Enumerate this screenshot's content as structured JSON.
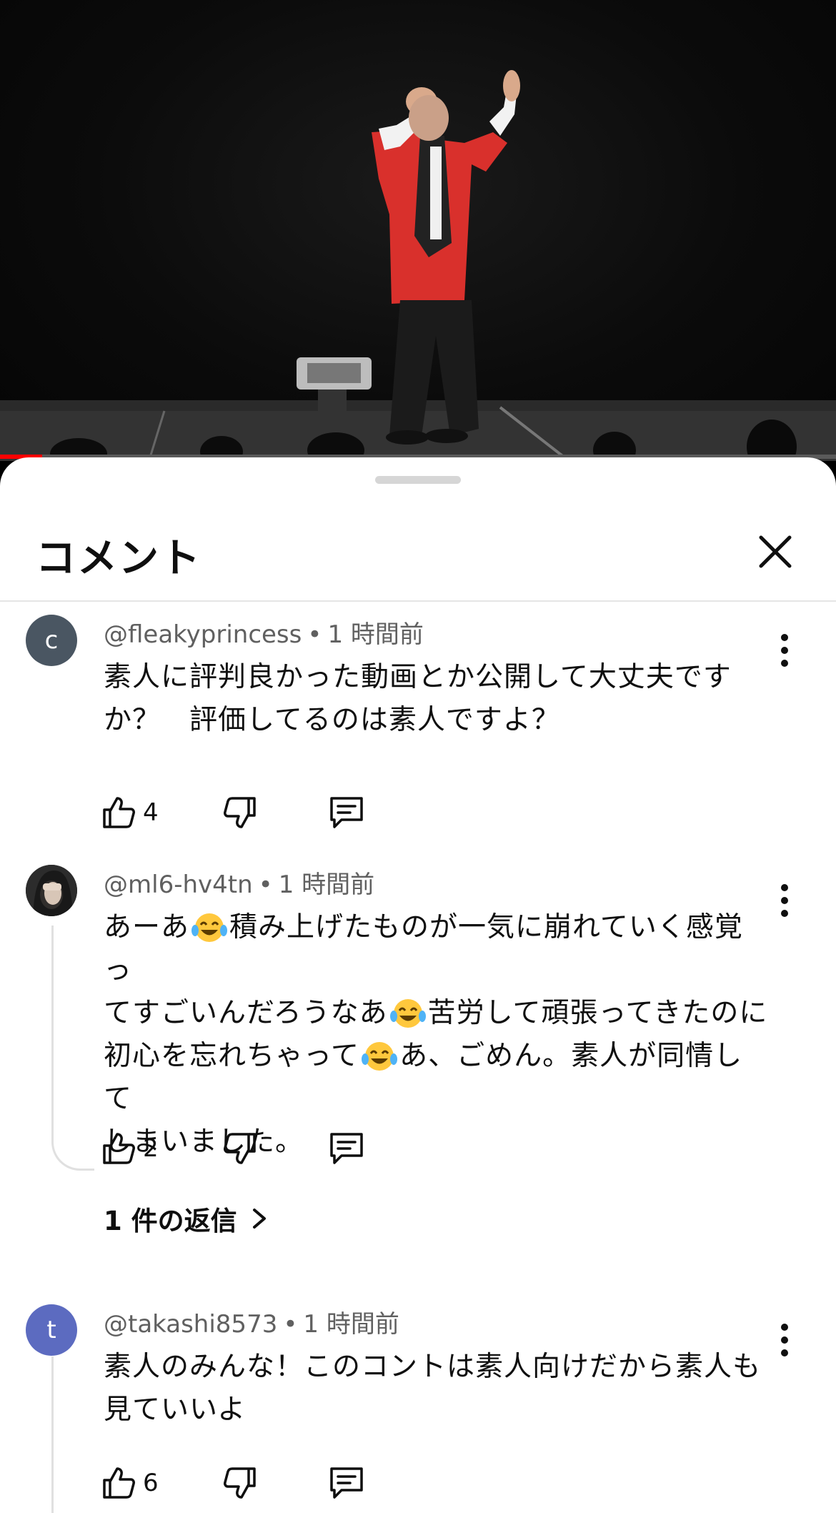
{
  "player": {
    "progress_fraction": 0.05
  },
  "panel": {
    "title": "コメント"
  },
  "comments": [
    {
      "avatar_letter": "c",
      "avatar_color": "#4a5662",
      "handle": "@fleakyprincess",
      "separator": "•",
      "time": "1 時間前",
      "lines": [
        "素人に評判良かった動画とか公開して大丈夫です",
        "か？　評価してるのは素人ですよ？"
      ],
      "likes": "4"
    },
    {
      "avatar_letter": "",
      "avatar_color": "#3a3a3a",
      "handle": "@ml6-hv4tn",
      "separator": "•",
      "time": "1 時間前",
      "segments": [
        [
          "あーあ",
          "積み上げたものが一気に崩れていく感覚っ"
        ],
        [
          "てすごいんだろうなあ",
          "苦労して頑張ってきたのに"
        ],
        [
          "初心を忘れちゃって",
          "あ、ごめん。素人が同情して"
        ],
        [
          "しまいました。"
        ]
      ],
      "emoji_name": "tears-of-joy-emoji",
      "likes": "2",
      "replies_label": "1 件の返信"
    },
    {
      "avatar_letter": "t",
      "avatar_color": "#5c6bc0",
      "handle": "@takashi8573",
      "separator": "•",
      "time": "1 時間前",
      "lines": [
        "素人のみんな！このコントは素人向けだから素人も",
        "見ていいよ"
      ],
      "likes": "6"
    }
  ]
}
